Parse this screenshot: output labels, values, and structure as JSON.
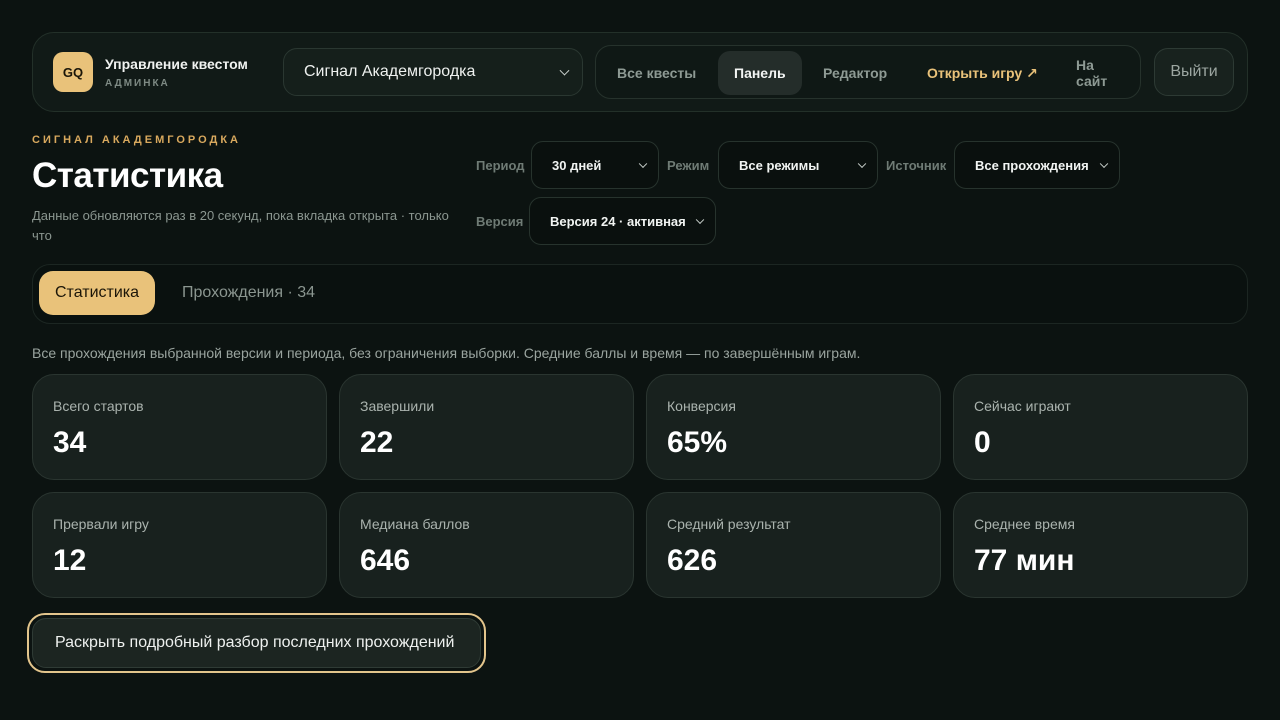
{
  "header": {
    "logo": "GQ",
    "title": "Управление квестом",
    "subtitle": "АДМИНКА",
    "quest_select": "Сигнал Академгородка",
    "nav": [
      "Все квесты",
      "Панель",
      "Редактор",
      "Открыть игру ↗",
      "На сайт"
    ],
    "logout": "Выйти"
  },
  "page": {
    "eyebrow": "СИГНАЛ АКАДЕМГОРОДКА",
    "title": "Статистика",
    "description": "Данные обновляются раз в 20 секунд, пока вкладка открыта · только что"
  },
  "filters": {
    "period_label": "Период",
    "period_value": "30 дней",
    "mode_label": "Режим",
    "mode_value": "Все режимы",
    "source_label": "Источник",
    "source_value": "Все прохождения",
    "version_label": "Версия",
    "version_value": "Версия 24 · активная"
  },
  "tabs": [
    "Статистика",
    "Прохождения · 34"
  ],
  "note": "Все прохождения выбранной версии и периода, без ограничения выборки. Средние баллы и время — по завершённым играм.",
  "stats": [
    {
      "label": "Всего стартов",
      "value": "34"
    },
    {
      "label": "Завершили",
      "value": "22"
    },
    {
      "label": "Конверсия",
      "value": "65%"
    },
    {
      "label": "Сейчас играют",
      "value": "0"
    },
    {
      "label": "Прервали игру",
      "value": "12"
    },
    {
      "label": "Медиана баллов",
      "value": "646"
    },
    {
      "label": "Средний результат",
      "value": "626"
    },
    {
      "label": "Среднее время",
      "value": "77 мин"
    }
  ],
  "expand_button": "Раскрыть подробный разбор последних прохождений",
  "colors": {
    "accent": "#e9c27a",
    "background": "#0c1311",
    "card": "#18211e"
  }
}
